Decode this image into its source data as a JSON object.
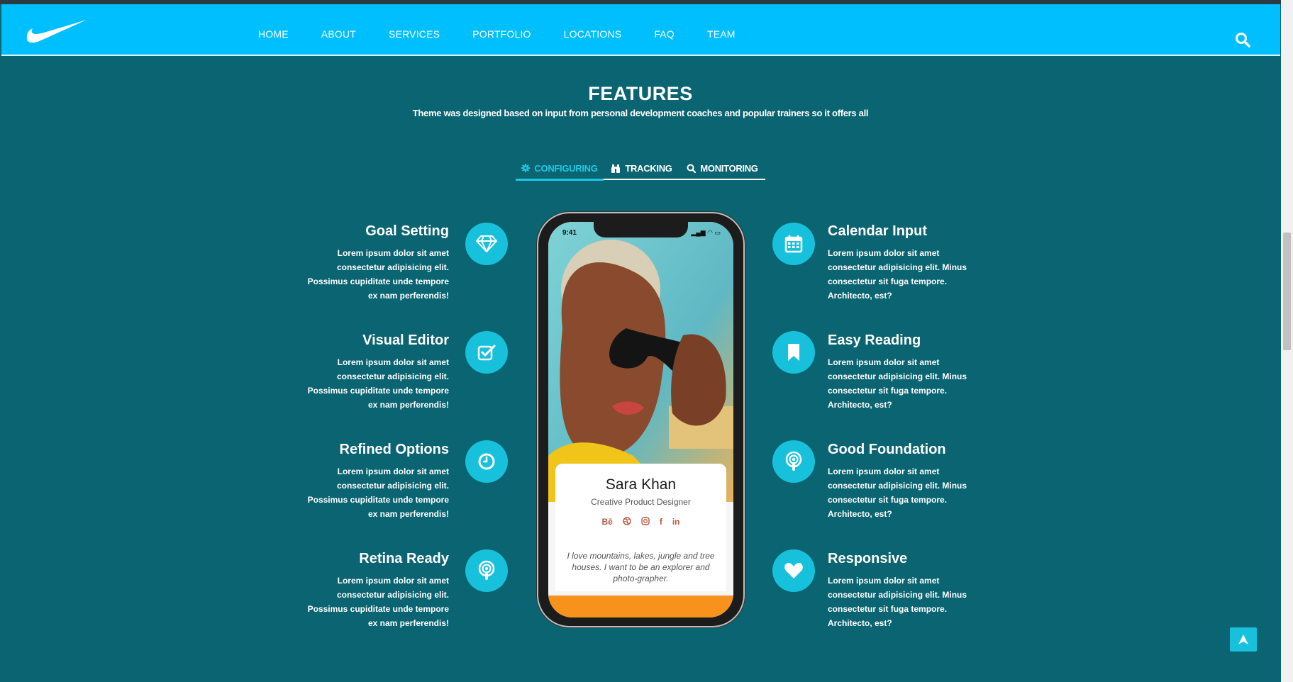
{
  "nav": {
    "items": [
      "HOME",
      "ABOUT",
      "SERVICES",
      "PORTFOLIO",
      "LOCATIONS",
      "FAQ",
      "TEAM"
    ]
  },
  "section": {
    "title": "FEATURES",
    "subtitle": "Theme was designed based on input from personal development coaches and popular trainers so it offers all"
  },
  "tabs": [
    {
      "label": "CONFIGURING",
      "icon": "gear-icon",
      "active": true
    },
    {
      "label": "TRACKING",
      "icon": "binoculars-icon",
      "active": false
    },
    {
      "label": "MONITORING",
      "icon": "search-icon",
      "active": false
    }
  ],
  "features_left": [
    {
      "title": "Goal Setting",
      "text": "Lorem ipsum dolor sit amet consectetur adipisicing elit. Possimus cupiditate unde tempore ex nam perferendis!",
      "icon": "diamond-icon"
    },
    {
      "title": "Visual Editor",
      "text": "Lorem ipsum dolor sit amet consectetur adipisicing elit. Possimus cupiditate unde tempore ex nam perferendis!",
      "icon": "check-square-icon"
    },
    {
      "title": "Refined Options",
      "text": "Lorem ipsum dolor sit amet consectetur adipisicing elit. Possimus cupiditate unde tempore ex nam perferendis!",
      "icon": "clock-icon"
    },
    {
      "title": "Retina Ready",
      "text": "Lorem ipsum dolor sit amet consectetur adipisicing elit. Possimus cupiditate unde tempore ex nam perferendis!",
      "icon": "podcast-icon"
    }
  ],
  "features_right": [
    {
      "title": "Calendar Input",
      "text": "Lorem ipsum dolor sit amet consectetur adipisicing elit. Minus consectetur sit fuga tempore. Architecto, est?",
      "icon": "calendar-icon"
    },
    {
      "title": "Easy Reading",
      "text": "Lorem ipsum dolor sit amet consectetur adipisicing elit. Minus consectetur sit fuga tempore. Architecto, est?",
      "icon": "bookmark-icon"
    },
    {
      "title": "Good Foundation",
      "text": "Lorem ipsum dolor sit amet consectetur adipisicing elit. Minus consectetur sit fuga tempore. Architecto, est?",
      "icon": "podcast-icon"
    },
    {
      "title": "Responsive",
      "text": "Lorem ipsum dolor sit amet consectetur adipisicing elit. Minus consectetur sit fuga tempore. Architecto, est?",
      "icon": "heart-icon"
    }
  ],
  "phone": {
    "time": "9:41",
    "name": "Sara Khan",
    "role": "Creative Product Designer",
    "social": [
      "Bē",
      "dribbble-icon",
      "instagram-icon",
      "f",
      "in"
    ],
    "quote": "I love mountains, lakes, jungle and tree houses. I want to be an explorer and photo-grapher."
  },
  "colors": {
    "navbar": "#00bfff",
    "background": "#0a6471",
    "accent": "#17c1dc",
    "orange": "#f7931d"
  }
}
